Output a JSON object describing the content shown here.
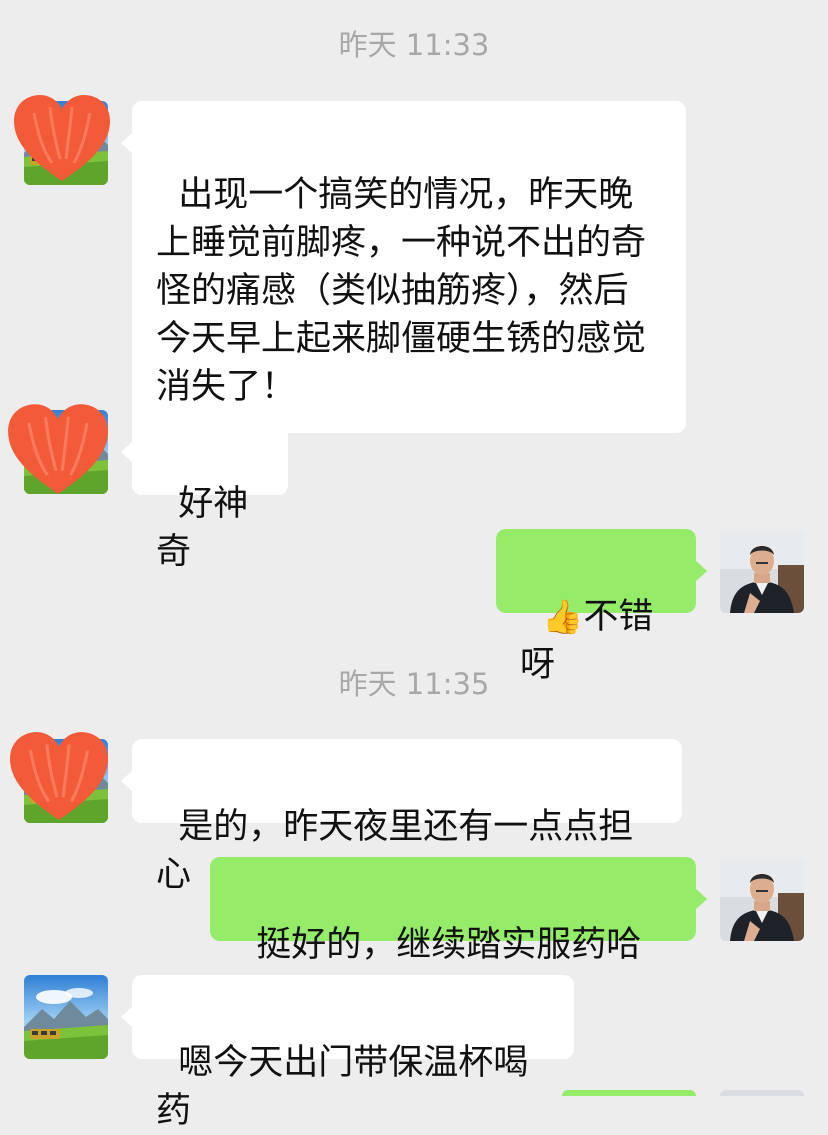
{
  "chat": {
    "timestamps": [
      "昨天 11:33",
      "昨天 11:35"
    ],
    "messages": [
      {
        "side": "in",
        "text": "出现一个搞笑的情况，昨天晚上睡觉前脚疼，一种说不出的奇怪的痛感（类似抽筋疼），然后今天早上起来脚僵硬生锈的感觉消失了！"
      },
      {
        "side": "in",
        "text": "好神奇"
      },
      {
        "side": "out",
        "emoji": "👍",
        "text": "不错呀"
      },
      {
        "side": "in",
        "text": "是的，昨天夜里还有一点点担心"
      },
      {
        "side": "out",
        "text": "挺好的，继续踏实服药哈",
        "emoji": "🤝"
      },
      {
        "side": "in",
        "text": "嗯今天出门带保温杯喝药"
      }
    ]
  },
  "avatars": {
    "contact": "landscape-photo-avatar",
    "contact_overlay": "red-heart-redaction",
    "self": "man-in-suit-photo-avatar"
  },
  "colors": {
    "background": "#ededed",
    "incoming_bubble": "#ffffff",
    "outgoing_bubble": "#95ec69",
    "timestamp_text": "#a8a8a8",
    "heart_redaction": "#f25a38"
  }
}
